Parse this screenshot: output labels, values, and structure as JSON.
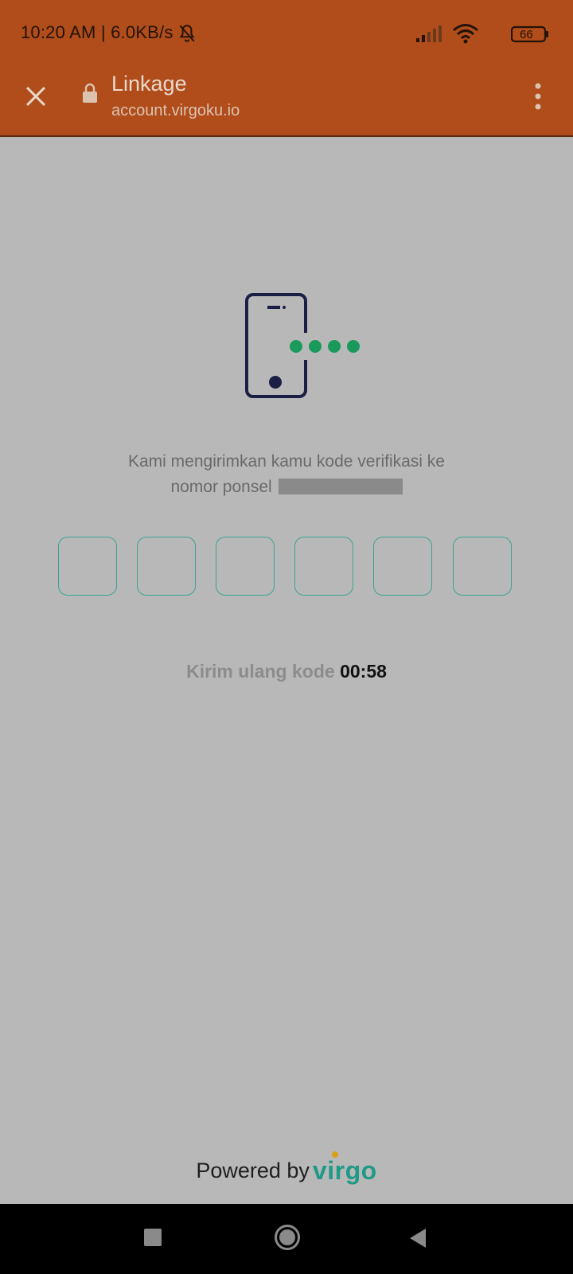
{
  "status_bar": {
    "time": "10:20 AM | 6.0KB/s",
    "battery": "66",
    "icons": [
      "bell-off-icon",
      "signal-icon",
      "wifi-icon",
      "battery-icon"
    ]
  },
  "toolbar": {
    "title": "Linkage",
    "url": "account.virgoku.io",
    "icons": [
      "close-icon",
      "lock-icon",
      "more-vert-icon"
    ]
  },
  "verification": {
    "message_line1": "Kami mengirimkan kamu kode verifikasi ke",
    "message_line2": "nomor ponsel",
    "otp_values": [
      "",
      "",
      "",
      "",
      "",
      ""
    ],
    "resend_label": "Kirim ulang kode",
    "timer": "00:58"
  },
  "footer": {
    "powered_by": "Powered by",
    "brand": "virgo"
  },
  "colors": {
    "header": "#b04d1b",
    "background": "#b8b8b8",
    "otp_border": "#3aa393",
    "brand_green": "#1f9a86",
    "dots_green": "#1a9a5a"
  },
  "nav_bar": {
    "icons": [
      "recent-apps-icon",
      "home-icon",
      "back-icon"
    ]
  }
}
